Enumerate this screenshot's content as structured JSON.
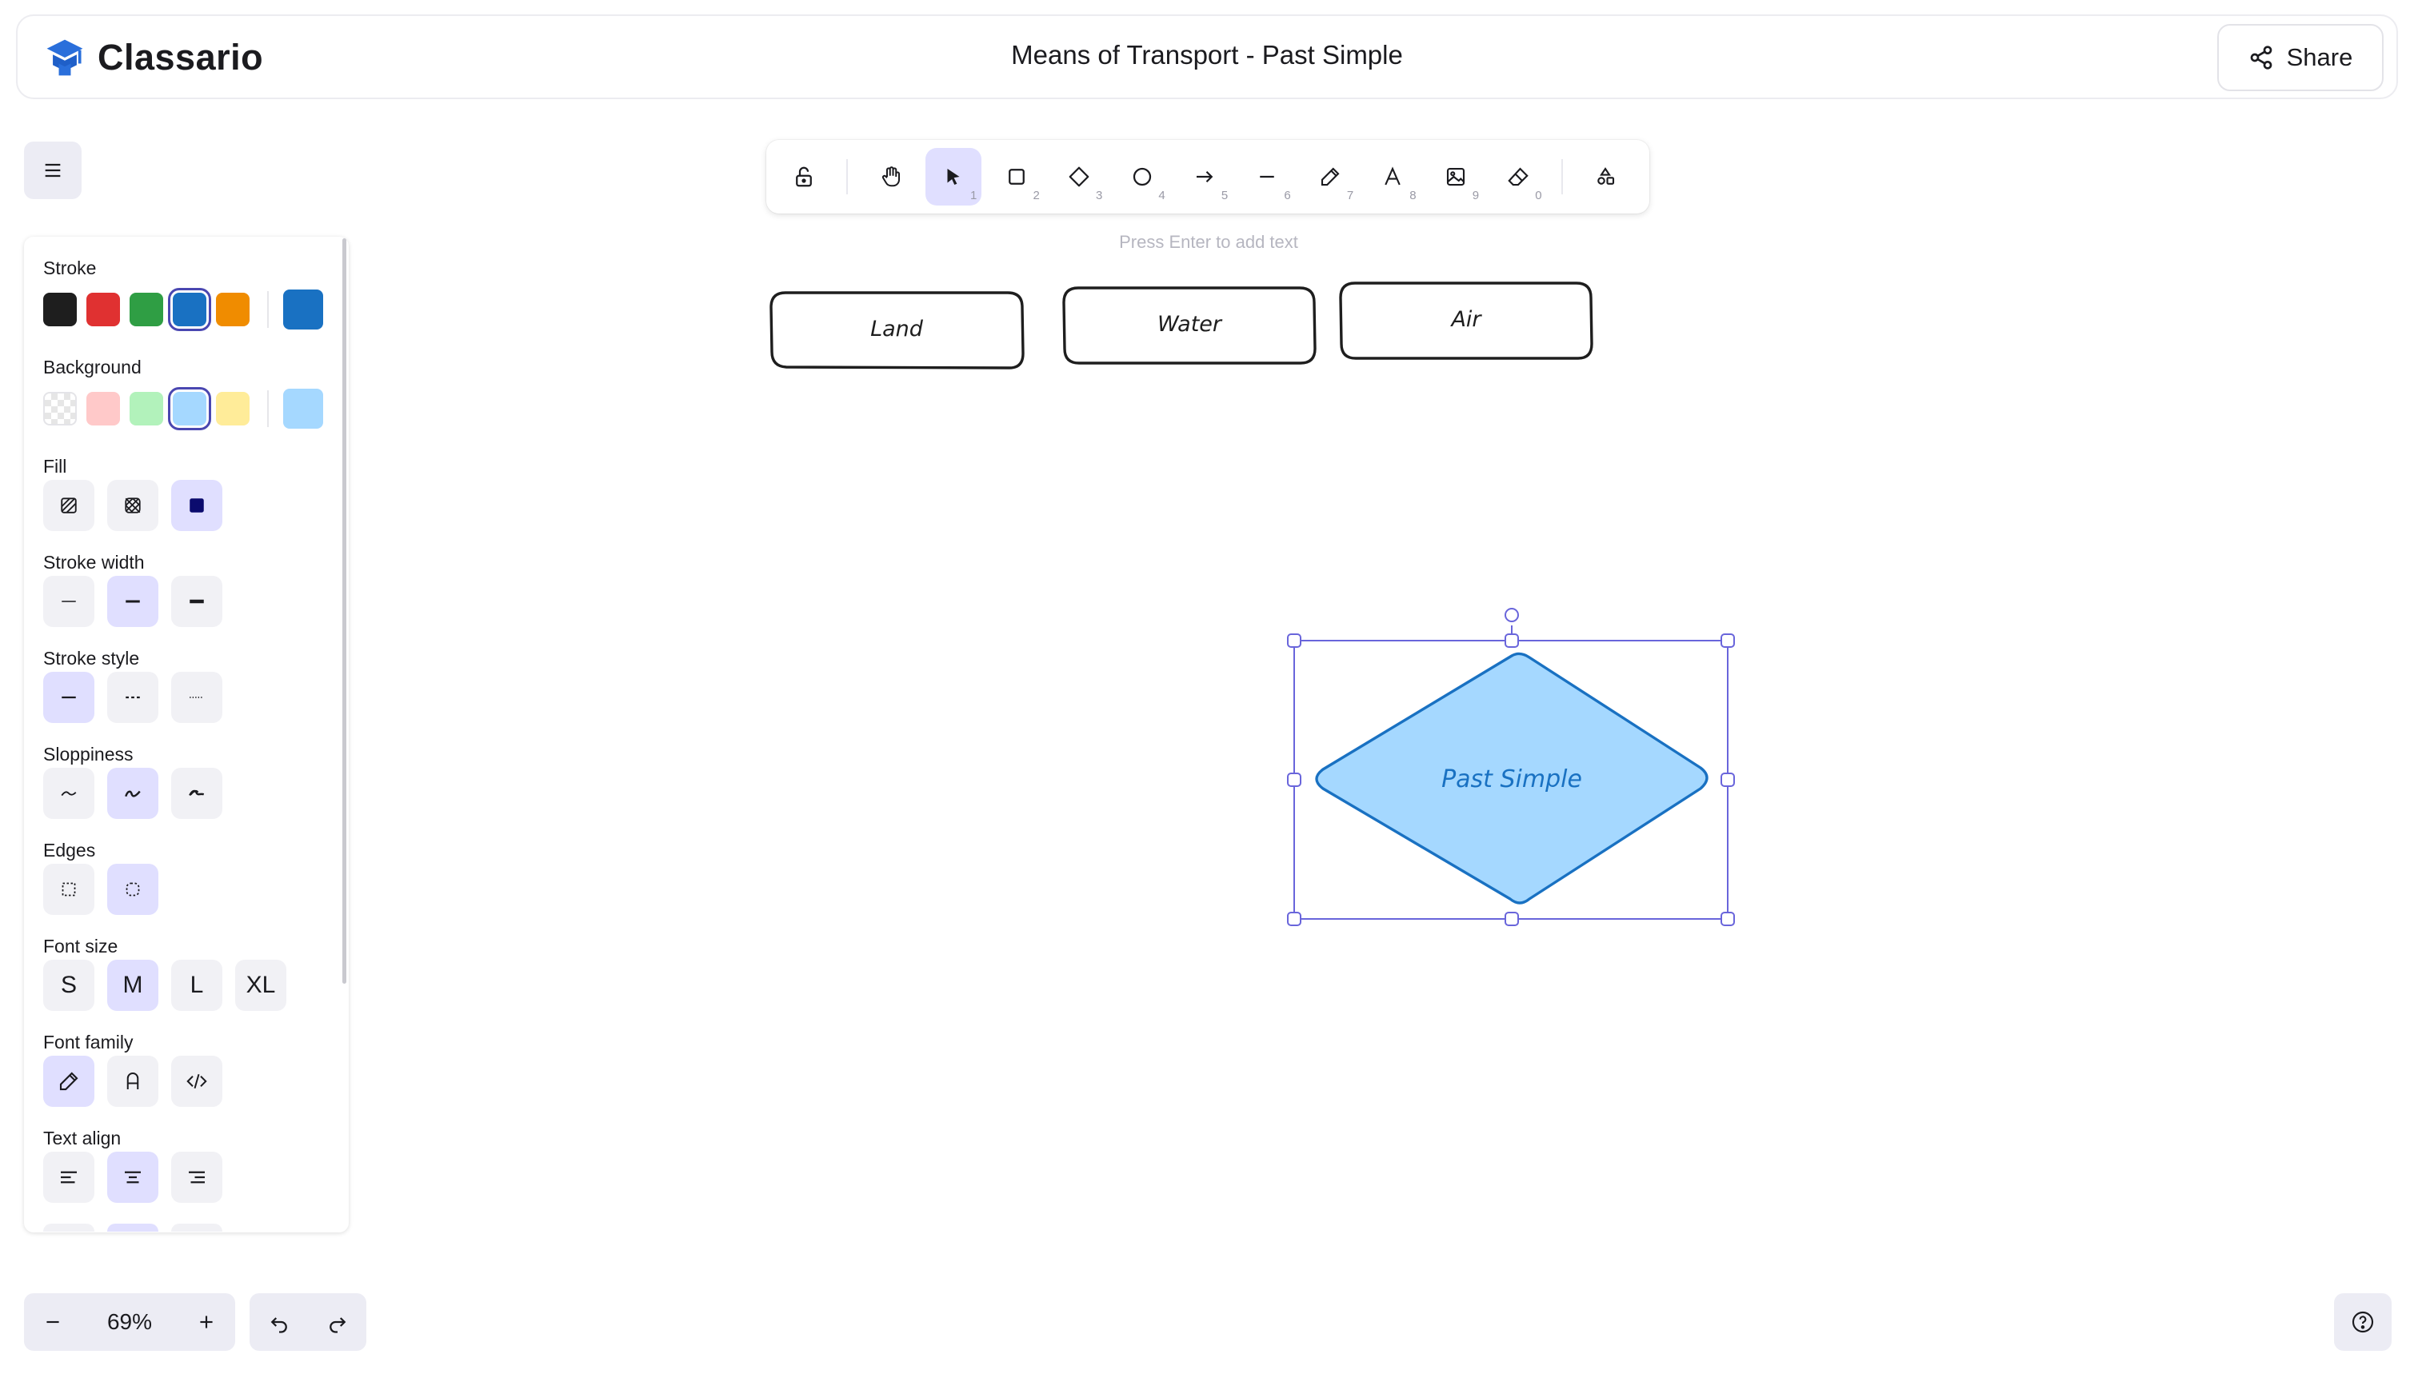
{
  "app": {
    "name": "Classario",
    "brand_color": "#2a6fdb"
  },
  "document": {
    "title": "Means of Transport - Past Simple"
  },
  "header": {
    "share_label": "Share",
    "share_icon": "share-icon"
  },
  "toolbar": {
    "hint": "Press Enter to add text",
    "tools": [
      {
        "name": "lock",
        "icon": "unlock-icon",
        "key": ""
      },
      {
        "name": "hand",
        "icon": "hand-icon",
        "key": ""
      },
      {
        "name": "selection",
        "icon": "pointer-icon",
        "key": "1",
        "active": true
      },
      {
        "name": "rectangle",
        "icon": "square-icon",
        "key": "2"
      },
      {
        "name": "diamond",
        "icon": "diamond-icon",
        "key": "3"
      },
      {
        "name": "ellipse",
        "icon": "circle-icon",
        "key": "4"
      },
      {
        "name": "arrow",
        "icon": "arrow-icon",
        "key": "5"
      },
      {
        "name": "line",
        "icon": "line-icon",
        "key": "6"
      },
      {
        "name": "draw",
        "icon": "pencil-icon",
        "key": "7"
      },
      {
        "name": "text",
        "icon": "text-icon",
        "key": "8"
      },
      {
        "name": "image",
        "icon": "image-icon",
        "key": "9"
      },
      {
        "name": "eraser",
        "icon": "eraser-icon",
        "key": "0"
      },
      {
        "name": "more-shapes",
        "icon": "shapes-icon",
        "key": ""
      }
    ]
  },
  "panel": {
    "stroke": {
      "label": "Stroke",
      "colors": [
        "#1e1e1e",
        "#e03131",
        "#2f9e44",
        "#1971c2",
        "#f08c00"
      ],
      "selected": "#1971c2",
      "current": "#1971c2"
    },
    "background": {
      "label": "Background",
      "colors": [
        "transparent",
        "#ffc9c9",
        "#b2f2bb",
        "#a5d8ff",
        "#ffec99"
      ],
      "selected": "#a5d8ff",
      "current": "#a5d8ff"
    },
    "fill": {
      "label": "Fill",
      "options": [
        "hachure",
        "cross-hatch",
        "solid"
      ],
      "selected": "solid"
    },
    "stroke_width": {
      "label": "Stroke width",
      "options": [
        "thin",
        "bold",
        "extra-bold"
      ],
      "selected": "bold"
    },
    "stroke_style": {
      "label": "Stroke style",
      "options": [
        "solid",
        "dashed",
        "dotted"
      ],
      "selected": "solid"
    },
    "sloppiness": {
      "label": "Sloppiness",
      "options": [
        "architect",
        "artist",
        "cartoonist"
      ],
      "selected": "artist"
    },
    "edges": {
      "label": "Edges",
      "options": [
        "sharp",
        "round"
      ],
      "selected": "round"
    },
    "font_size": {
      "label": "Font size",
      "options": [
        "S",
        "M",
        "L",
        "XL"
      ],
      "selected": "M"
    },
    "font_family": {
      "label": "Font family",
      "options": [
        "hand-drawn",
        "normal",
        "code"
      ],
      "selected": "hand-drawn"
    },
    "text_align": {
      "label": "Text align",
      "options": [
        "left",
        "center",
        "right"
      ],
      "selected": "center"
    }
  },
  "canvas": {
    "boxes": [
      {
        "label": "Land"
      },
      {
        "label": "Water"
      },
      {
        "label": "Air"
      }
    ],
    "diamond": {
      "label": "Past Simple",
      "fill": "#a5d8ff",
      "stroke": "#1971c2",
      "selected": true
    },
    "selection_color": "#6965db"
  },
  "footer": {
    "zoom": "69%"
  }
}
